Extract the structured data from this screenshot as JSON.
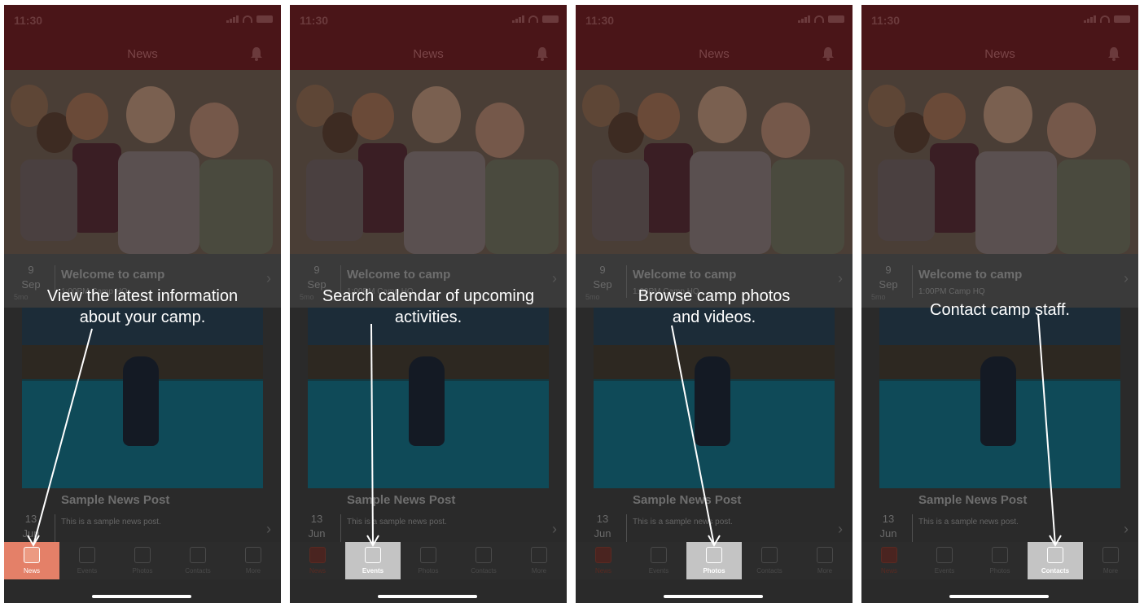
{
  "status_time": "11:30",
  "screen_title": "News",
  "post1": {
    "day": "9",
    "month": "Sep",
    "ago": "5mo",
    "title": "Welcome to camp",
    "subtitle": "1:00PM Camp HQ"
  },
  "post2": {
    "day": "13",
    "month": "Jun",
    "title": "Sample News Post",
    "body": "This is a sample news post."
  },
  "tabs": [
    "News",
    "Events",
    "Photos",
    "Contacts",
    "More"
  ],
  "panels": [
    {
      "tip": "View the latest information\nabout your camp.",
      "active_tab": 0
    },
    {
      "tip": "Search calendar of upcoming\nactivities.",
      "active_tab": 1
    },
    {
      "tip": "Browse camp photos\nand videos.",
      "active_tab": 2
    },
    {
      "tip": "Contact camp staff.",
      "active_tab": 3
    }
  ],
  "colors": {
    "header": "#4a1518",
    "highlight": "#c4c4c4",
    "news_active": "#e48068",
    "overlay_text": "#ffffff"
  }
}
